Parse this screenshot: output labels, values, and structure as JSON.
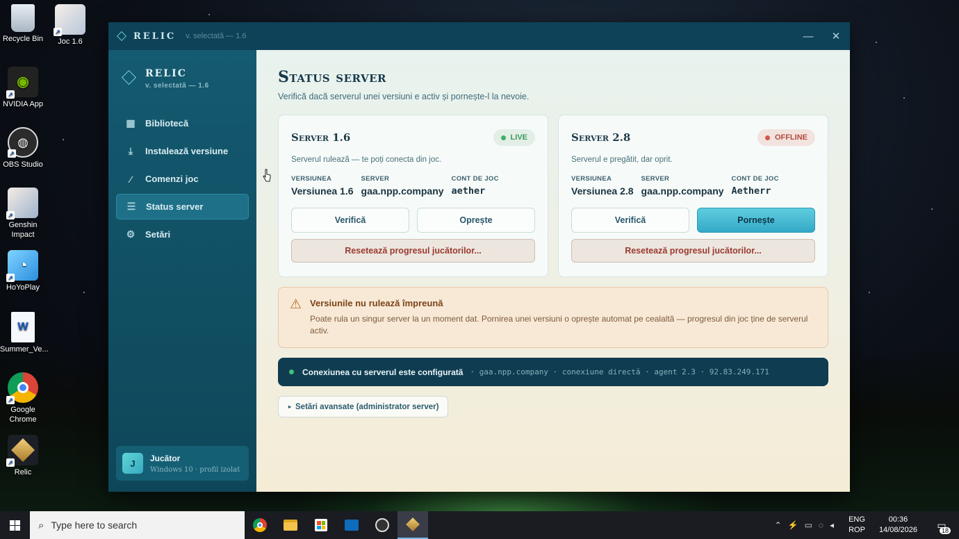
{
  "desktop": {
    "icons": [
      {
        "label": "Recycle Bin",
        "icon": "recycle-bin-icon"
      },
      {
        "label": "Joc 1.6",
        "icon": "game-icon"
      },
      {
        "label": "NVIDIA App",
        "icon": "nvidia-icon"
      },
      {
        "label": "OBS Studio",
        "icon": "obs-icon"
      },
      {
        "label": "Genshin Impact",
        "icon": "genshin-icon"
      },
      {
        "label": "HoYoPlay",
        "icon": "hoyoplay-icon"
      },
      {
        "label": "Summer_Ve...",
        "icon": "word-document-icon"
      },
      {
        "label": "Google Chrome",
        "icon": "chrome-icon"
      },
      {
        "label": "Relic",
        "icon": "relic-icon"
      }
    ]
  },
  "window": {
    "brand": "RELIC",
    "version": "v. selectată — 1.6",
    "minimize": "—",
    "close": "✕"
  },
  "sidebar": {
    "brand": "RELIC",
    "version": "v. selectată — 1.6",
    "items": [
      {
        "label": "Bibliotecă",
        "icon": "grid-icon"
      },
      {
        "label": "Instalează versiune",
        "icon": "download-icon"
      },
      {
        "label": "Comenzi joc",
        "icon": "wand-icon"
      },
      {
        "label": "Status server",
        "icon": "server-icon"
      },
      {
        "label": "Setări",
        "icon": "gear-icon"
      }
    ],
    "active_index": 3,
    "user": {
      "initial": "J",
      "name": "Jucător",
      "subtitle": "Windows 10 · profil izolat"
    }
  },
  "main": {
    "title": "Status server",
    "subtitle": "Verifică dacă serverul unei versiuni e activ și pornește-l la nevoie.",
    "servers": [
      {
        "title": "Server 1.6",
        "status": "LIVE",
        "status_color": "#3fb06a",
        "description": "Serverul rulează — te poți conecta din joc.",
        "labels": {
          "version": "VERSIUNEA",
          "server": "SERVER",
          "account": "CONT DE JOC"
        },
        "version": "Versiunea 1.6",
        "server": "gaa.npp.company",
        "account": "aether",
        "verify_label": "Verifică",
        "action_label": "Oprește",
        "reset_label": "Resetează progresul jucătorilor..."
      },
      {
        "title": "Server 2.8",
        "status": "OFFLINE",
        "status_color": "#d2574a",
        "description": "Serverul e pregătit, dar oprit.",
        "labels": {
          "version": "VERSIUNEA",
          "server": "SERVER",
          "account": "CONT DE JOC"
        },
        "version": "Versiunea 2.8",
        "server": "gaa.npp.company",
        "account": "Aetherr",
        "verify_label": "Verifică",
        "action_label": "Pornește",
        "reset_label": "Resetează progresul jucătorilor..."
      }
    ],
    "warning": {
      "title": "Versiunile nu rulează împreună",
      "text": "Poate rula un singur server la un moment dat. Pornirea unei versiuni o oprește automat pe cealaltă — progresul din joc ține de serverul activ."
    },
    "connection": {
      "title": "Conexiunea cu serverul este configurată",
      "meta": "· gaa.npp.company · conexiune directă · agent 2.3 · 92.83.249.171"
    },
    "advanced_label": "Setări avansate (administrator server)"
  },
  "taskbar": {
    "search_placeholder": "Type here to search",
    "apps": [
      "chrome-icon",
      "file-explorer-icon",
      "store-icon",
      "mail-icon",
      "obs-icon",
      "relic-icon"
    ],
    "lang_top": "ENG",
    "lang_bottom": "ROP",
    "time": "00:36",
    "date": "14/08/2026",
    "notifications": "18"
  }
}
